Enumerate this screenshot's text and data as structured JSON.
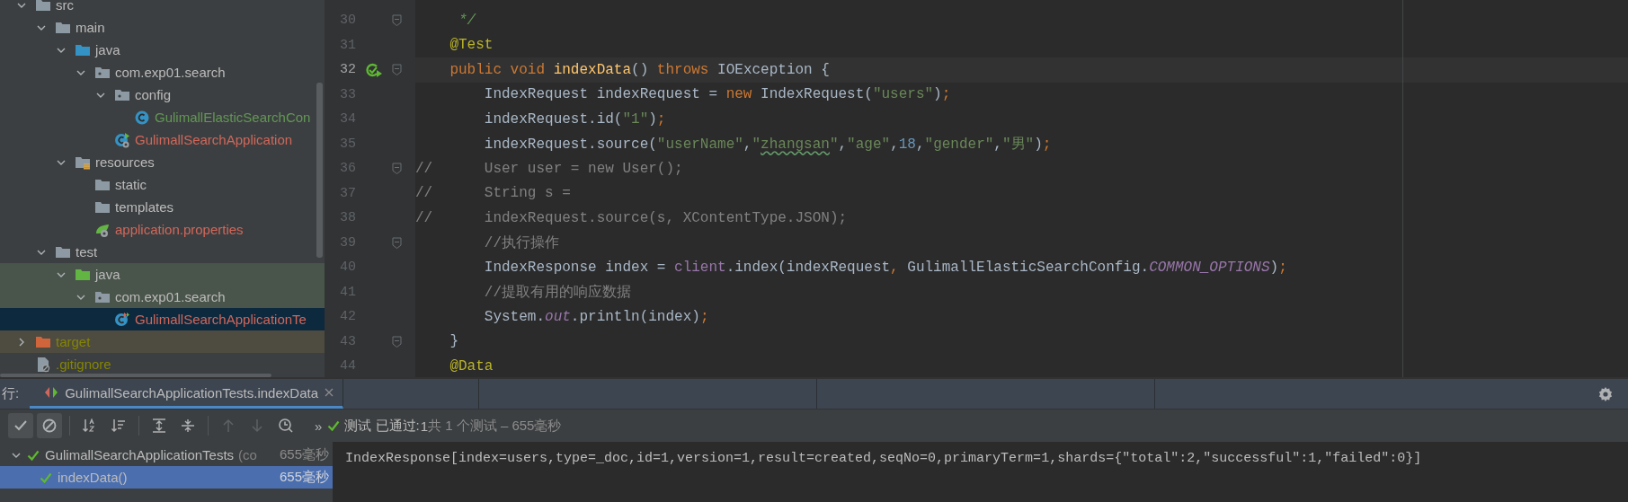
{
  "project_tree": [
    {
      "label": "src",
      "kind": "folder",
      "highlight": false,
      "expanded": true,
      "selected": false,
      "children": [
        {
          "label": "main",
          "kind": "folder",
          "highlight": false,
          "expanded": true,
          "selected": false,
          "children": [
            {
              "label": "java",
              "kind": "source-folder",
              "highlight": false,
              "expanded": true,
              "selected": false,
              "children": [
                {
                  "label": "com.exp01.search",
                  "kind": "package",
                  "highlight": false,
                  "expanded": true,
                  "selected": false,
                  "children": [
                    {
                      "label": "config",
                      "kind": "package",
                      "highlight": false,
                      "expanded": true,
                      "selected": false,
                      "children": [
                        {
                          "label": "GulimallElasticSearchCon",
                          "kind": "class",
                          "color": "#629755",
                          "highlight": false,
                          "selected": false
                        }
                      ]
                    },
                    {
                      "label": "GulimallSearchApplication",
                      "kind": "spring-class",
                      "color": "#d1675a",
                      "highlight": false,
                      "selected": false
                    }
                  ]
                }
              ]
            },
            {
              "label": "resources",
              "kind": "resources-folder",
              "highlight": false,
              "expanded": true,
              "selected": false,
              "children": [
                {
                  "label": "static",
                  "kind": "folder",
                  "highlight": false,
                  "selected": false
                },
                {
                  "label": "templates",
                  "kind": "folder",
                  "highlight": false,
                  "selected": false
                },
                {
                  "label": "application.properties",
                  "kind": "spring-properties",
                  "color": "#d1675a",
                  "highlight": false,
                  "selected": false
                }
              ]
            }
          ]
        },
        {
          "label": "test",
          "kind": "folder",
          "highlight": false,
          "expanded": true,
          "selected": false,
          "children": [
            {
              "label": "java",
              "kind": "test-folder",
              "highlight": true,
              "expanded": true,
              "selected": false,
              "children": [
                {
                  "label": "com.exp01.search",
                  "kind": "package",
                  "highlight": true,
                  "expanded": true,
                  "selected": false,
                  "children": [
                    {
                      "label": "GulimallSearchApplicationTe",
                      "kind": "test-class",
                      "color": "#d1675a",
                      "highlight": false,
                      "selected": true
                    }
                  ]
                }
              ]
            }
          ]
        }
      ]
    },
    {
      "label": "target",
      "kind": "excluded-folder",
      "color": "#848504",
      "highlight": true,
      "expanded": false,
      "selected": false
    },
    {
      "label": ".gitignore",
      "kind": "ignore-file",
      "color": "#848504",
      "highlight": false,
      "selected": false
    }
  ],
  "editor": {
    "lines": [
      {
        "number": "30",
        "current": false,
        "run": false,
        "fold": true,
        "tokens": [
          {
            "kind": "doc",
            "s": "     */"
          }
        ]
      },
      {
        "number": "31",
        "current": false,
        "run": false,
        "fold": false,
        "tokens": [
          {
            "kind": "annotation",
            "s": "    @Test"
          }
        ]
      },
      {
        "number": "32",
        "current": true,
        "run": true,
        "fold": true,
        "tokens": [
          {
            "kind": "keyword",
            "s": "    public void "
          },
          {
            "kind": "method",
            "s": "indexData"
          },
          {
            "kind": "plain",
            "s": "() "
          },
          {
            "kind": "keyword",
            "s": "throws "
          },
          {
            "kind": "plain",
            "s": "IOException {"
          }
        ]
      },
      {
        "number": "33",
        "current": false,
        "run": false,
        "fold": false,
        "tokens": [
          {
            "kind": "plain",
            "s": "        IndexRequest indexRequest = "
          },
          {
            "kind": "keyword",
            "s": "new "
          },
          {
            "kind": "plain",
            "s": "IndexRequest("
          },
          {
            "kind": "string",
            "s": "\"users\""
          },
          {
            "kind": "plain",
            "s": ")"
          },
          {
            "kind": "keyword",
            "s": ";"
          }
        ]
      },
      {
        "number": "34",
        "current": false,
        "run": false,
        "fold": false,
        "tokens": [
          {
            "kind": "plain",
            "s": "        indexRequest.id("
          },
          {
            "kind": "string",
            "s": "\"1\""
          },
          {
            "kind": "plain",
            "s": ")"
          },
          {
            "kind": "keyword",
            "s": ";"
          }
        ]
      },
      {
        "number": "35",
        "current": false,
        "run": false,
        "fold": false,
        "tokens": [
          {
            "kind": "plain",
            "s": "        indexRequest.source("
          },
          {
            "kind": "string",
            "s": "\"userName\""
          },
          {
            "kind": "plain",
            "s": ","
          },
          {
            "kind": "string",
            "s": "\""
          },
          {
            "kind": "string",
            "s": "zhangsan",
            "typo": true
          },
          {
            "kind": "string",
            "s": "\""
          },
          {
            "kind": "plain",
            "s": ","
          },
          {
            "kind": "string",
            "s": "\"age\""
          },
          {
            "kind": "plain",
            "s": ","
          },
          {
            "kind": "number",
            "s": "18"
          },
          {
            "kind": "plain",
            "s": ","
          },
          {
            "kind": "string",
            "s": "\"gender\""
          },
          {
            "kind": "plain",
            "s": ","
          },
          {
            "kind": "string",
            "s": "\"男\""
          },
          {
            "kind": "plain",
            "s": ")"
          },
          {
            "kind": "keyword",
            "s": ";"
          }
        ]
      },
      {
        "number": "36",
        "current": false,
        "run": false,
        "fold": true,
        "tokens": [
          {
            "kind": "comment",
            "s": "//      User user = new User();"
          }
        ]
      },
      {
        "number": "37",
        "current": false,
        "run": false,
        "fold": false,
        "tokens": [
          {
            "kind": "comment",
            "s": "//      String s ="
          }
        ]
      },
      {
        "number": "38",
        "current": false,
        "run": false,
        "fold": false,
        "tokens": [
          {
            "kind": "comment",
            "s": "//      indexRequest.source(s, XContentType.JSON);"
          }
        ]
      },
      {
        "number": "39",
        "current": false,
        "run": false,
        "fold": true,
        "tokens": [
          {
            "kind": "comment",
            "s": "        //执行操作"
          }
        ]
      },
      {
        "number": "40",
        "current": false,
        "run": false,
        "fold": false,
        "tokens": [
          {
            "kind": "plain",
            "s": "        IndexResponse index = "
          },
          {
            "kind": "field",
            "s": "client"
          },
          {
            "kind": "plain",
            "s": ".index(indexRequest"
          },
          {
            "kind": "keyword",
            "s": ", "
          },
          {
            "kind": "plain",
            "s": "GulimallElasticSearchConfig."
          },
          {
            "kind": "static",
            "s": "COMMON_OPTIONS"
          },
          {
            "kind": "plain",
            "s": ")"
          },
          {
            "kind": "keyword",
            "s": ";"
          }
        ]
      },
      {
        "number": "41",
        "current": false,
        "run": false,
        "fold": false,
        "tokens": [
          {
            "kind": "comment",
            "s": "        //提取有用的响应数据"
          }
        ]
      },
      {
        "number": "42",
        "current": false,
        "run": false,
        "fold": false,
        "tokens": [
          {
            "kind": "plain",
            "s": "        System."
          },
          {
            "kind": "static",
            "s": "out"
          },
          {
            "kind": "plain",
            "s": ".println(index)"
          },
          {
            "kind": "keyword",
            "s": ";"
          }
        ]
      },
      {
        "number": "43",
        "current": false,
        "run": false,
        "fold": true,
        "tokens": [
          {
            "kind": "plain",
            "s": "    }"
          }
        ]
      },
      {
        "number": "44",
        "current": false,
        "run": false,
        "fold": false,
        "tokens": [
          {
            "kind": "annotation",
            "s": "    @Data"
          }
        ]
      }
    ]
  },
  "run_panel": {
    "title": "行:",
    "tabs": [
      {
        "label": "GulimallSearchApplicationTests.indexData",
        "selected": true
      }
    ],
    "toolbar": [
      {
        "kind": "check",
        "selected": true,
        "disabled": false,
        "divider_before": false
      },
      {
        "kind": "cancel",
        "selected": true,
        "disabled": false,
        "divider_before": false
      },
      {
        "kind": "sort-alpha",
        "selected": false,
        "disabled": false,
        "divider_before": true
      },
      {
        "kind": "sort-duration",
        "selected": false,
        "disabled": false,
        "divider_before": false
      },
      {
        "kind": "expand-all",
        "selected": false,
        "disabled": false,
        "divider_before": true
      },
      {
        "kind": "collapse-all",
        "selected": false,
        "disabled": false,
        "divider_before": false
      },
      {
        "kind": "arrow-up",
        "selected": false,
        "disabled": true,
        "divider_before": true
      },
      {
        "kind": "arrow-down",
        "selected": false,
        "disabled": true,
        "divider_before": false
      },
      {
        "kind": "history",
        "selected": false,
        "disabled": false,
        "divider_before": false
      }
    ],
    "more": "»",
    "status": {
      "passed": true,
      "label": "测试 已通过:",
      "count": "1",
      "detail": "共 1 个测试 – 655毫秒"
    },
    "tests": [
      {
        "label": "GulimallSearchApplicationTests",
        "hint": "(co",
        "time": "655毫秒",
        "passed": true,
        "expanded": true,
        "selected": false,
        "children": [
          {
            "label": "indexData()",
            "time": "655毫秒",
            "passed": true,
            "selected": true
          }
        ]
      }
    ],
    "console": [
      "IndexResponse[index=users,type=_doc,id=1,version=1,result=created,seqNo=0,primaryTerm=1,shards={\"total\":2,\"successful\":1,\"failed\":0}]"
    ]
  }
}
